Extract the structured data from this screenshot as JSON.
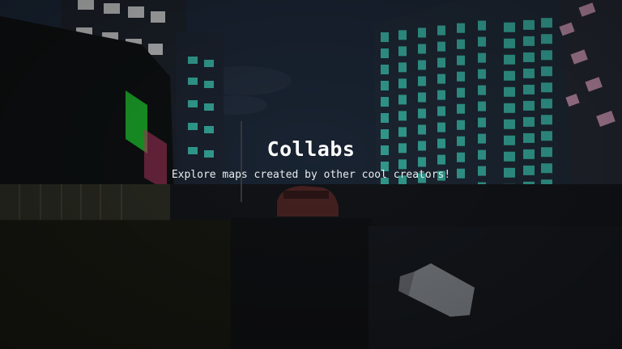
{
  "screen": {
    "title": "Collabs",
    "subtitle": "Explore maps created by other cool creators!"
  },
  "colors": {
    "window_lit": "#3fd8c0",
    "window_white": "#e8e8e8",
    "window_pink": "#e8a8c8",
    "sign_green": "#1fbe2e",
    "title_text": "#ffffff"
  },
  "icons": []
}
